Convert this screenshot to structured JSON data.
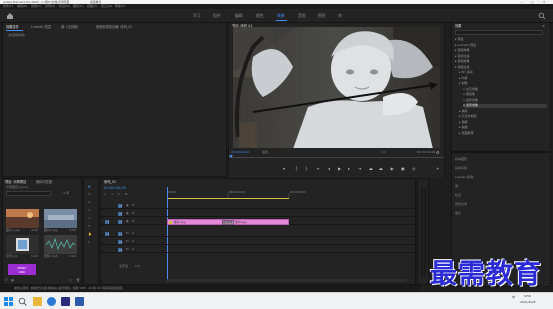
{
  "window": {
    "title": "Adobe Premiere Pro 2020 - C:\\用户\\文档\\示例项目",
    "title_suffix": "最需教育"
  },
  "menubar": {
    "items": [
      "文件(F)",
      "编辑(E)",
      "剪辑(C)",
      "序列(S)",
      "标记(M)",
      "图形(G)",
      "视图(V)",
      "窗口(W)",
      "帮助(H)"
    ]
  },
  "workspaces": {
    "tabs": [
      "学习",
      "组件",
      "编辑",
      "颜色",
      "效果",
      "音频",
      "图形",
      "库"
    ],
    "active": "效果"
  },
  "source_panel": {
    "tabs": [
      "效果控件",
      "Lumetri 范围",
      "源: (无剪辑)",
      "音频剪辑混合器: 序列_01"
    ],
    "empty_message": "(未选择剪辑)"
  },
  "program_monitor": {
    "tab": "节目: 序列_01",
    "timecode_current": "00;00;00;00",
    "fit": "适合",
    "resolution": "1/2",
    "timecode_total": "00;00;09;29"
  },
  "effects_panel": {
    "title": "效果",
    "tree": [
      {
        "label": "预设",
        "level": 0
      },
      {
        "label": "Lumetri 预设",
        "level": 0
      },
      {
        "label": "音频效果",
        "level": 0
      },
      {
        "label": "音频过渡",
        "level": 0
      },
      {
        "label": "视频效果",
        "level": 0
      },
      {
        "label": "视频过渡",
        "level": 0
      },
      {
        "label": "3D 运动",
        "level": 1
      },
      {
        "label": "内滑",
        "level": 1
      },
      {
        "label": "划像",
        "level": 1
      },
      {
        "label": "交叉划像",
        "level": 2
      },
      {
        "label": "圆划像",
        "level": 2
      },
      {
        "label": "盒形划像",
        "level": 2
      },
      {
        "label": "菱形划像",
        "level": 2
      },
      {
        "label": "擦除",
        "level": 1
      },
      {
        "label": "沉浸式视频",
        "level": 1
      },
      {
        "label": "溶解",
        "level": 1
      },
      {
        "label": "缩放",
        "level": 1
      },
      {
        "label": "页面剥落",
        "level": 1
      }
    ],
    "selected": "菱形划像",
    "extra_panels": [
      "基本图形",
      "基本声音",
      "Lumetri 颜色",
      "库",
      "标记",
      "历史记录",
      "信息"
    ]
  },
  "project_panel": {
    "tabs": [
      "项目: 示例项目",
      "媒体浏览器"
    ],
    "project_file": "示例项目.prproj",
    "item_count": "4 项",
    "items": [
      {
        "name": "图片1.jpg",
        "duration": "4;29"
      },
      {
        "name": "图片2.jpg",
        "duration": "4;29"
      },
      {
        "name": "序列_01",
        "duration": "9;29"
      },
      {
        "name": "音频.mp3",
        "duration": "4;29"
      }
    ],
    "badge": "MENU\nLINK"
  },
  "timeline": {
    "tab": "序列_01",
    "timecode": "00;00;00;00",
    "ruler": [
      "00;00",
      "00;00;04;29",
      "00;00;09;29"
    ],
    "video_tracks": [
      "V3",
      "V2",
      "V1"
    ],
    "audio_tracks": [
      "A1",
      "A2",
      "A3"
    ],
    "master": "主声道",
    "master_level": "0.0",
    "clips": [
      {
        "label": "图片1.jpg",
        "track": "V1",
        "start": 0,
        "end": 4.98
      },
      {
        "label": "图片2.jpg",
        "track": "V1",
        "start": 4.98,
        "end": 9.96
      }
    ],
    "transition_label": "菱形划像",
    "sequence_end": 9.96,
    "view_end": 20
  },
  "statusbar": {
    "text": "单击以选择，或单击空白处并拖动以进行框选。使用 Shift、Alt 和 Ctrl 键获得其他选项。"
  },
  "taskbar": {
    "time": "9:56",
    "date": "2021/10/8",
    "lang": "中"
  },
  "watermark": "最需教育",
  "colors": {
    "accent": "#3d8df5",
    "clip": "#e58ad8",
    "playhead": "#4a8cf0"
  }
}
